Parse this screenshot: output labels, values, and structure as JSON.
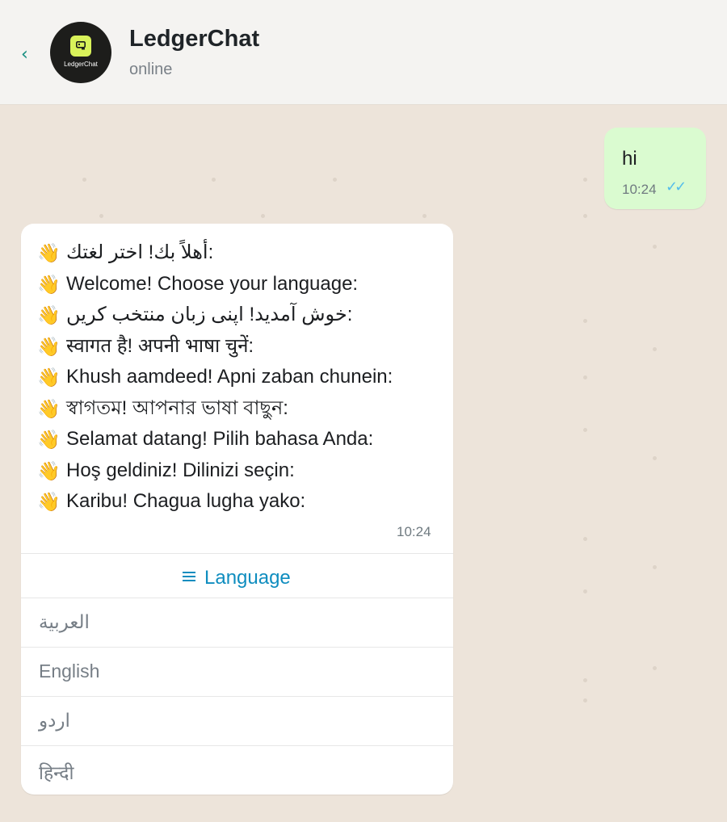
{
  "header": {
    "title": "LedgerChat",
    "status": "online",
    "avatar_text": "LedgerChat",
    "back_icon": "chevron-left-icon"
  },
  "outgoing": {
    "text": "hi",
    "time": "10:24",
    "ticks": "✓✓"
  },
  "incoming": {
    "wave_emoji": "👋",
    "lines": [
      "أهلاً بك! اختر لغتك:",
      "Welcome! Choose your language:",
      "خوش آمدید! اپنی زبان منتخب کریں:",
      "स्वागत है! अपनी भाषा चुनें:",
      "Khush aamdeed! Apni zaban chunein:",
      "স্বাগতম! আপনার ভাষা বাছুন:",
      "Selamat datang! Pilih bahasa Anda:",
      "Hoş geldiniz! Dilinizi seçin:",
      "Karibu! Chagua lugha yako:"
    ],
    "time": "10:24",
    "menu_button": {
      "label": "Language",
      "icon": "menu-list-icon"
    },
    "options": [
      "العربية",
      "English",
      "اردو",
      "हिन्दी"
    ]
  },
  "colors": {
    "chat_background": "#ede4da",
    "header_background": "#f4f3f1",
    "outgoing_bubble": "#dafbd0",
    "accent_link": "#0f8dbf",
    "read_ticks": "#53bdeb",
    "back_arrow": "#128c7e",
    "logo_accent": "#d9f25a"
  }
}
